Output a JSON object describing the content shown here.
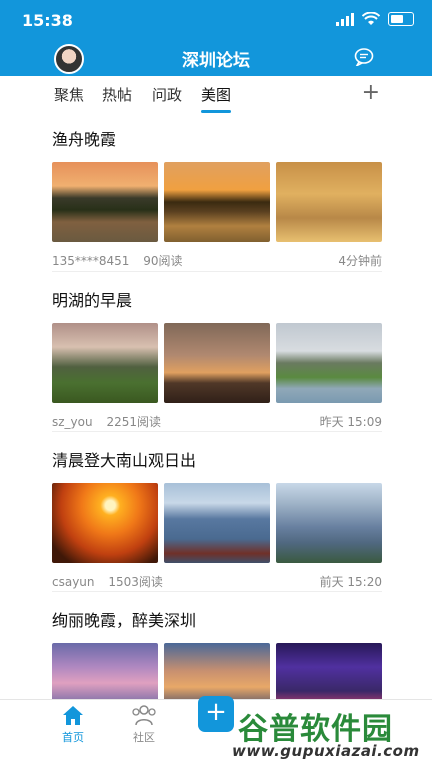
{
  "status": {
    "time": "15:38"
  },
  "header": {
    "title": "深圳论坛"
  },
  "tabs": [
    "聚焦",
    "热帖",
    "问政",
    "美图"
  ],
  "posts": [
    {
      "title": "渔舟晚霞",
      "author": "135****8451",
      "reads": "90阅读",
      "time": "4分钟前"
    },
    {
      "title": "明湖的早晨",
      "author": "sz_you",
      "reads": "2251阅读",
      "time": "昨天 15:09"
    },
    {
      "title": "清晨登大南山观日出",
      "author": "csayun",
      "reads": "1503阅读",
      "time": "前天 15:20"
    },
    {
      "title": "绚丽晚霞，醉美深圳"
    }
  ],
  "tabbar": {
    "home": "首页",
    "community": "社区",
    "post": "发帖"
  },
  "watermark": {
    "big": "谷普软件园",
    "small": "www.gupuxiazai.com"
  },
  "colors": {
    "accent": "#1296db"
  }
}
